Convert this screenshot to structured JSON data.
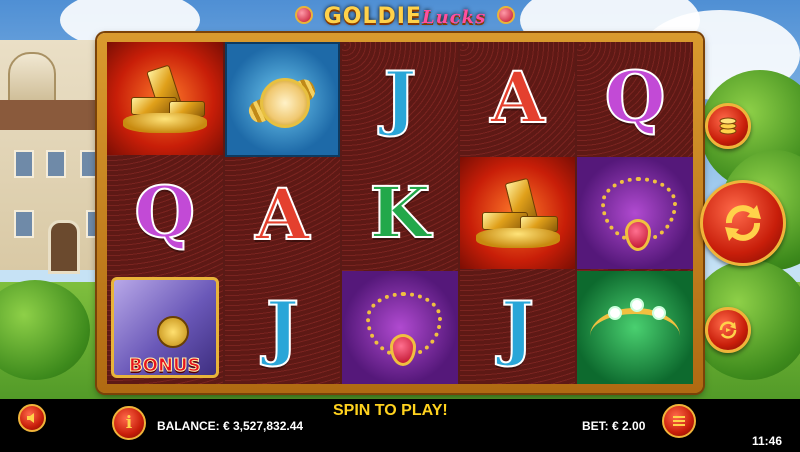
{
  "title": {
    "main": "GOLDIE",
    "script": "Lucks"
  },
  "reels": [
    [
      {
        "symbol": "gold-bars"
      },
      {
        "symbol": "Q"
      },
      {
        "symbol": "bonus-safe",
        "label": "BONUS"
      }
    ],
    [
      {
        "symbol": "gold-watch"
      },
      {
        "symbol": "A"
      },
      {
        "symbol": "J"
      }
    ],
    [
      {
        "symbol": "J"
      },
      {
        "symbol": "K"
      },
      {
        "symbol": "ruby-necklace"
      }
    ],
    [
      {
        "symbol": "A"
      },
      {
        "symbol": "gold-bars"
      },
      {
        "symbol": "J"
      }
    ],
    [
      {
        "symbol": "Q"
      },
      {
        "symbol": "ruby-necklace"
      },
      {
        "symbol": "diamond-tiara"
      }
    ]
  ],
  "letters": {
    "r1_q": "Q",
    "r2_a": "A",
    "r2_j": "J",
    "r3_j": "J",
    "r3_k": "K",
    "r4_a": "A",
    "r4_j": "J",
    "r5_q": "Q"
  },
  "bonus_label": "BONUS",
  "bottom_bar": {
    "balance": "BALANCE: € 3,527,832.44",
    "message": "SPIN TO PLAY!",
    "bet": "BET: € 2.00",
    "clock": "11:46"
  },
  "controls": {
    "coins": "coins-icon",
    "spin": "spin-arrows-icon",
    "autoplay": "autoplay-icon",
    "sound": "speaker-icon",
    "info": "info-icon",
    "menu": "menu-icon"
  },
  "colors": {
    "accent_gold": "#f0b43a",
    "button_red": "#c81e0a",
    "message_yellow": "#ffd21e"
  }
}
